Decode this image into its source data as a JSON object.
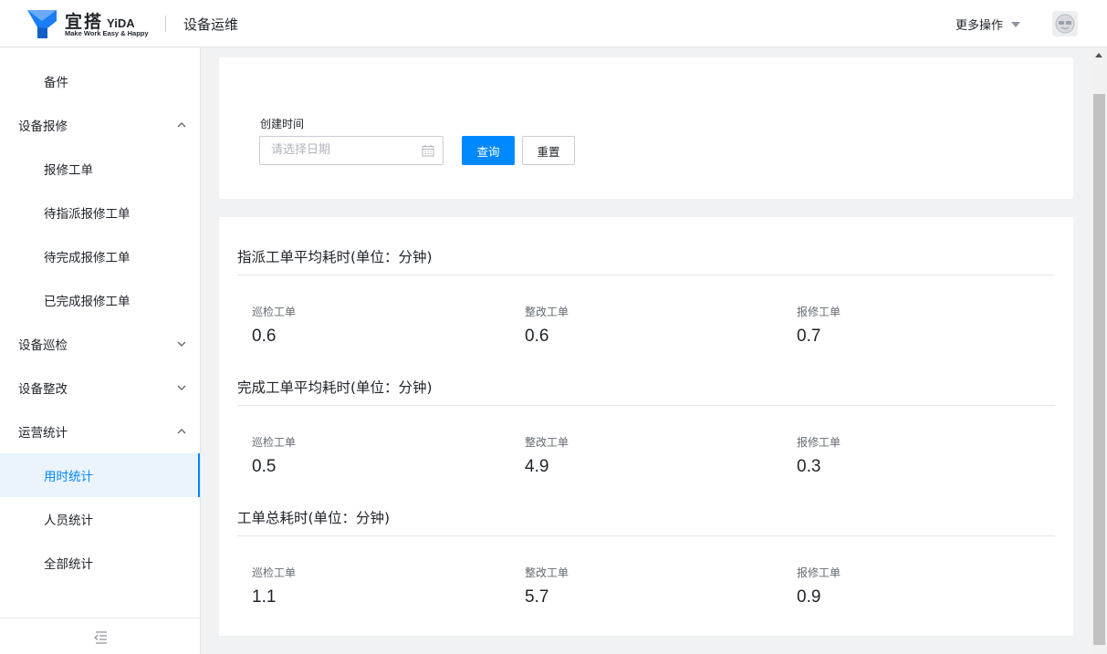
{
  "header": {
    "logo_cn": "宜搭",
    "logo_en": "YiDA",
    "logo_slogan": "Make Work Easy & Happy",
    "app_title": "设备运维",
    "more_actions": "更多操作"
  },
  "sidebar": {
    "items": [
      {
        "label": "备件",
        "level": "sub"
      },
      {
        "label": "设备报修",
        "level": "group",
        "expanded": true
      },
      {
        "label": "报修工单",
        "level": "sub"
      },
      {
        "label": "待指派报修工单",
        "level": "sub"
      },
      {
        "label": "待完成报修工单",
        "level": "sub"
      },
      {
        "label": "已完成报修工单",
        "level": "sub"
      },
      {
        "label": "设备巡检",
        "level": "group",
        "expanded": false
      },
      {
        "label": "设备整改",
        "level": "group",
        "expanded": false
      },
      {
        "label": "运营统计",
        "level": "group",
        "expanded": true
      },
      {
        "label": "用时统计",
        "level": "sub",
        "active": true
      },
      {
        "label": "人员统计",
        "level": "sub"
      },
      {
        "label": "全部统计",
        "level": "sub"
      }
    ]
  },
  "filter": {
    "label": "创建时间",
    "date_placeholder": "请选择日期",
    "query_button": "查询",
    "reset_button": "重置"
  },
  "stats": {
    "sections": [
      {
        "title": "指派工单平均耗时(单位：分钟)",
        "items": [
          {
            "label": "巡检工单",
            "value": "0.6"
          },
          {
            "label": "整改工单",
            "value": "0.6"
          },
          {
            "label": "报修工单",
            "value": "0.7"
          }
        ]
      },
      {
        "title": "完成工单平均耗时(单位：分钟)",
        "items": [
          {
            "label": "巡检工单",
            "value": "0.5"
          },
          {
            "label": "整改工单",
            "value": "4.9"
          },
          {
            "label": "报修工单",
            "value": "0.3"
          }
        ]
      },
      {
        "title": "工单总耗时(单位：分钟)",
        "items": [
          {
            "label": "巡检工单",
            "value": "1.1"
          },
          {
            "label": "整改工单",
            "value": "5.7"
          },
          {
            "label": "报修工单",
            "value": "0.9"
          }
        ]
      }
    ]
  },
  "colors": {
    "accent": "#0089ff",
    "logo_blue": "#1b7df6",
    "active_bg": "#ebf3fd"
  },
  "icons": {
    "logo": "yida-logo-icon",
    "more_caret": "caret-down-icon",
    "avatar": "user-avatar-icon",
    "calendar": "calendar-icon",
    "chevron_up": "chevron-up-icon",
    "chevron_down": "chevron-down-icon",
    "collapse": "menu-collapse-icon"
  }
}
